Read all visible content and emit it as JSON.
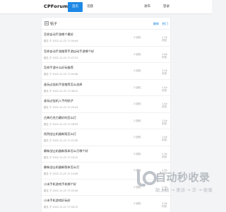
{
  "header": {
    "logo": "CPForum",
    "nav": [
      {
        "label": "首页",
        "active": true
      },
      {
        "label": "话题",
        "active": false
      }
    ],
    "post_link": "发布",
    "login_link": "登录"
  },
  "section": {
    "title": "帖子",
    "icon": "document-icon",
    "tabs": {
      "latest": "最新",
      "hot": "热门"
    }
  },
  "posts": [
    {
      "title": "怎样自动手游哪个最好",
      "meta": "匿名 于 2022-12-22 17:00:44",
      "replies": "2 回帖",
      "views": "1.7k 浏览"
    },
    {
      "title": "怎样自动手游推荐手游自动手游哪个好",
      "meta": "匿名 于 2022-12-22 17:47:23",
      "replies": "2 回帖",
      "views": "1.6k 浏览"
    },
    {
      "title": "怎样手游什么好玩推荐",
      "meta": "匿名 于 2022-12-22 17:45:08",
      "replies": "2 回帖",
      "views": "1.5k 浏览"
    },
    {
      "title": "谁玩过挂机手游推荐怎么选择",
      "meta": "匿名 于 2022-12-22 17:38:22",
      "replies": "2 回帖",
      "views": "1.4k 浏览"
    },
    {
      "title": "谁玩过挂机入手的帖子",
      "meta": "匿名 于 2022-12-22 17:29:43",
      "replies": "2 回帖",
      "views": "1.4k 浏览"
    },
    {
      "title": "古典巧克力最好的怎么打",
      "meta": "匿名 于 2022-12-22 17:28:09",
      "replies": "2 回帖",
      "views": "1.4k 浏览"
    },
    {
      "title": "找到战士机器新版怎么打",
      "meta": "匿名 于 2022-12-22 17:22:30",
      "replies": "2 回帖",
      "views": "1.4k 浏览"
    },
    {
      "title": "最新战士机器新版本怎么打哪个好",
      "meta": "匿名 于 2022-12-22 17:18:22",
      "replies": "2 回帖",
      "views": "1.3k 浏览"
    },
    {
      "title": "最新战士机器新版本怎么打",
      "meta": "匿名 于 2022-12-22 17:10:08",
      "replies": "2 回帖",
      "views": "1.3k 浏览"
    },
    {
      "title": "小米手机游戏手机哪个好",
      "meta": "匿名 于 2022-12-22 17:03:40",
      "replies": "2 回帖",
      "views": "1.3k 浏览"
    },
    {
      "title": "小米手机游戏好玩好",
      "meta": "匿名 于 2022-12-22 17:00:12",
      "replies": "2 回帖",
      "views": "1.3k 浏览"
    }
  ],
  "watermark": {
    "title": "自动秒收录",
    "subtitle": "助上线 → 来访 → 次 → 收录"
  }
}
